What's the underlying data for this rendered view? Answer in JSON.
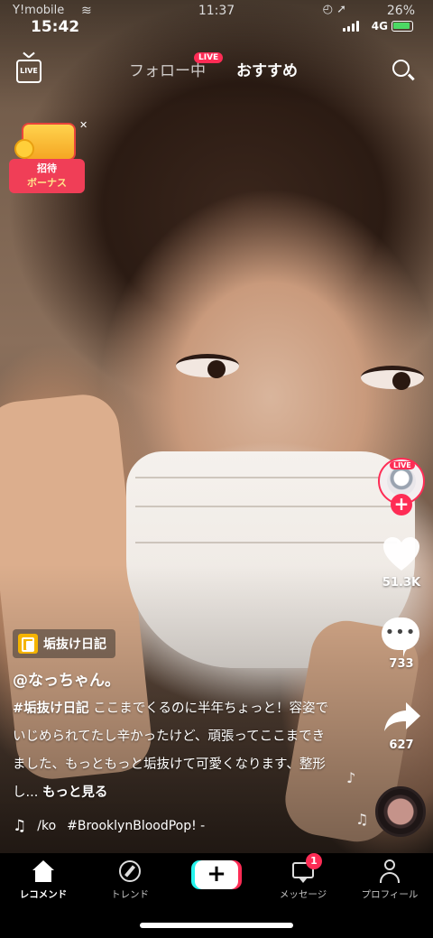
{
  "status_bar": {
    "carrier": "Y!mobile",
    "time_small": "11:37",
    "time_big": "15:42",
    "battery": "26%",
    "network": "4G"
  },
  "top_nav": {
    "live_label": "LIVE",
    "following_tab": "フォロー中",
    "following_live_badge": "LIVE",
    "recommended_tab": "おすすめ"
  },
  "invite_bonus": {
    "line1": "招待",
    "line2": "ボーナス"
  },
  "right_rail": {
    "avatar_live_badge": "LIVE",
    "likes": "51.3K",
    "comments": "733",
    "shares": "627"
  },
  "post": {
    "playlist_chip": "垢抜け日記",
    "username": "@なっちゃん。",
    "hashtag": "#垢抜け日記",
    "caption": " ここまでくるのに半年ちょっと！容姿でいじめられてたし辛かったけど、頑張ってここまできました、もっともっと垢抜けて可愛くなります、整形し...",
    "more": "もっと見る",
    "music_user": "/ko",
    "music_track": "#BrooklynBloodPop! -"
  },
  "bottom_nav": {
    "home": "レコメンド",
    "trend": "トレンド",
    "add": "+",
    "messages": "メッセージ",
    "messages_badge": "1",
    "profile": "プロフィール"
  },
  "colors": {
    "accent_pink": "#fe2c55",
    "accent_cyan": "#25f4ee"
  }
}
